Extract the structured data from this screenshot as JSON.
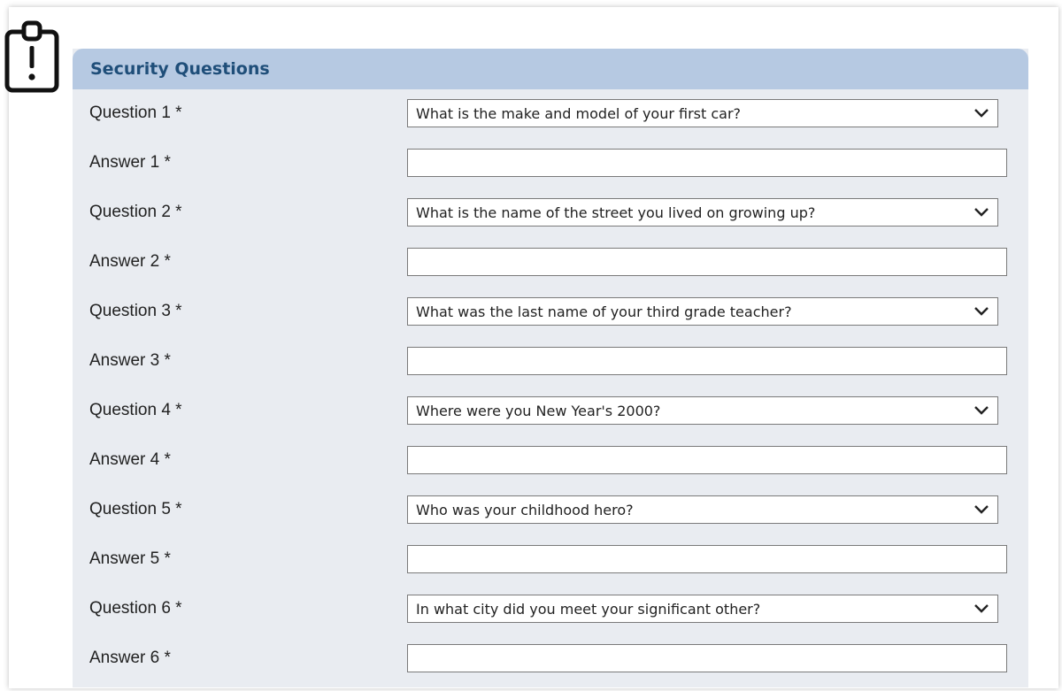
{
  "panel": {
    "title": "Security Questions"
  },
  "icons": {
    "alert": "clipboard-alert-icon",
    "dropdown": "chevron-down-icon"
  },
  "colors": {
    "header_bg": "#b6c9e2",
    "header_text": "#1f4e79",
    "panel_bg": "#e9ecf1"
  },
  "form": {
    "rows": [
      {
        "label": "Question 1 *",
        "value": "What is the make and model of your first car?"
      },
      {
        "label": "Answer 1 *",
        "value": ""
      },
      {
        "label": "Question 2 *",
        "value": "What is the name of the street you lived on growing up?"
      },
      {
        "label": "Answer 2 *",
        "value": ""
      },
      {
        "label": "Question 3 *",
        "value": "What was the last name of your third grade teacher?"
      },
      {
        "label": "Answer 3 *",
        "value": ""
      },
      {
        "label": "Question 4 *",
        "value": "Where were you New Year's 2000?"
      },
      {
        "label": "Answer 4 *",
        "value": ""
      },
      {
        "label": "Question 5 *",
        "value": "Who was your childhood hero?"
      },
      {
        "label": "Answer 5 *",
        "value": ""
      },
      {
        "label": "Question 6 *",
        "value": "In what city did you meet your significant other?"
      },
      {
        "label": "Answer 6 *",
        "value": ""
      }
    ]
  }
}
